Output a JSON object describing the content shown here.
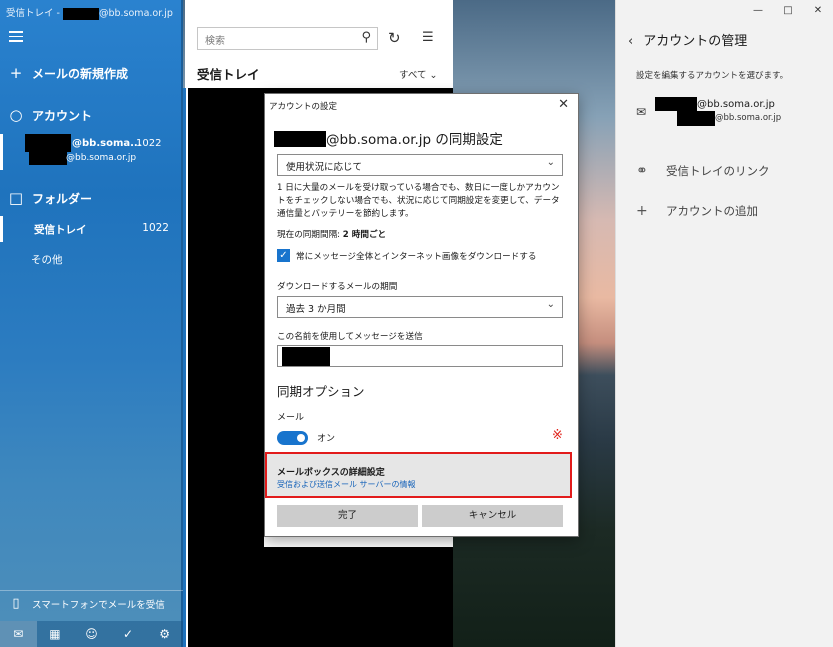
{
  "window": {
    "title_prefix": "受信トレイ - ",
    "title_suffix": "@bb.soma.or.jp"
  },
  "sidebar": {
    "new_mail": "メールの新規作成",
    "accounts_label": "アカウント",
    "account": {
      "email_short": "@bb.soma...",
      "unread": "1022",
      "email_domain": "@bb.soma.or.jp"
    },
    "folders_label": "フォルダー",
    "folders": [
      {
        "name": "受信トレイ",
        "count": "1022"
      },
      {
        "name": "その他",
        "count": ""
      }
    ],
    "phone_promo": "スマートフォンでメールを受信"
  },
  "list": {
    "search_placeholder": "検索",
    "title": "受信トレイ",
    "filter": "すべて"
  },
  "account_panel": {
    "title": "アカウントの管理",
    "subtitle": "設定を編集するアカウントを選びます。",
    "email_line1": "@bb.soma.or.jp",
    "email_line2": "@bb.soma.or.jp",
    "link_inboxes": "受信トレイのリンク",
    "add_account": "アカウントの追加"
  },
  "dialog": {
    "title": "アカウントの設定",
    "sync_heading_suffix": "@bb.soma.or.jp の同期設定",
    "download_new_value": "使用状況に応じて",
    "description": "1 日に大量のメールを受け取っている場合でも、数日に一度しかアカウントをチェックしない場合でも、状況に応じて同期設定を変更して、データ通信量とバッテリーを節約します。",
    "current_interval_label": "現在の同期間隔: ",
    "current_interval_value": "2 時間ごと",
    "always_download": "常にメッセージ全体とインターネット画像をダウンロードする",
    "download_period_label": "ダウンロードするメールの期間",
    "download_period_value": "過去 3 か月間",
    "send_name_label": "この名前を使用してメッセージを送信",
    "sync_options": "同期オプション",
    "mail_label": "メール",
    "mail_toggle": "オン",
    "annotation_mark": "※",
    "mailbox_advanced_title": "メールボックスの詳細設定",
    "mailbox_advanced_sub": "受信および送信メール サーバーの情報",
    "done": "完了",
    "cancel": "キャンセル"
  },
  "colors": {
    "accent": "#1874cd",
    "highlight_border": "#e21b1b",
    "sidebar": "#1f73bd"
  }
}
